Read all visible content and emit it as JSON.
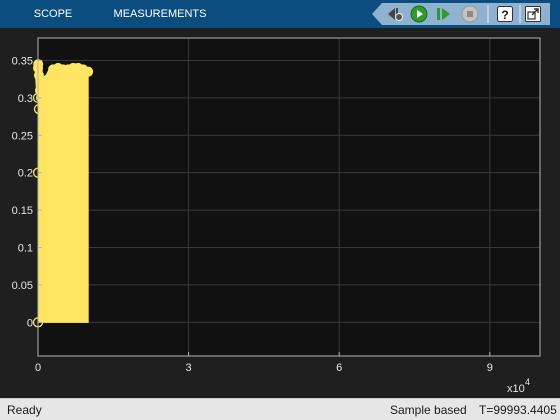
{
  "toolstrip": {
    "tabs": [
      {
        "label": "SCOPE"
      },
      {
        "label": "MEASUREMENTS"
      }
    ],
    "buttons": [
      {
        "icon": "step-back-icon"
      },
      {
        "icon": "run-icon"
      },
      {
        "icon": "step-forward-icon"
      },
      {
        "icon": "stop-icon"
      },
      {
        "icon": "help-icon"
      },
      {
        "icon": "undock-icon"
      }
    ]
  },
  "chart_data": {
    "type": "area",
    "x": [
      0,
      50,
      200,
      400,
      600,
      1000,
      1500,
      2000,
      3000,
      4000,
      5000,
      6000,
      7000,
      8000,
      9000,
      10000
    ],
    "values": [
      0.34,
      0.345,
      0.33,
      0.31,
      0.3,
      0.315,
      0.32,
      0.325,
      0.338,
      0.34,
      0.338,
      0.338,
      0.34,
      0.34,
      0.338,
      0.335
    ],
    "xlim": [
      0,
      100000
    ],
    "ylim": [
      -0.045,
      0.38
    ],
    "xticks": [
      0,
      3,
      6,
      9
    ],
    "yticks": [
      0,
      0.05,
      0.1,
      0.15,
      0.2,
      0.25,
      0.3,
      0.35
    ],
    "x_scale_label": "x10",
    "x_scale_exponent": "4",
    "grid": true,
    "colors": {
      "series": "#ffe561",
      "background": "#111111",
      "axis": "#b3b3b3",
      "grid": "#3a3a3a",
      "tick_label": "#e6e6e6"
    }
  },
  "status": {
    "ready": "Ready",
    "mode": "Sample based",
    "time": "T=99993.4405"
  }
}
